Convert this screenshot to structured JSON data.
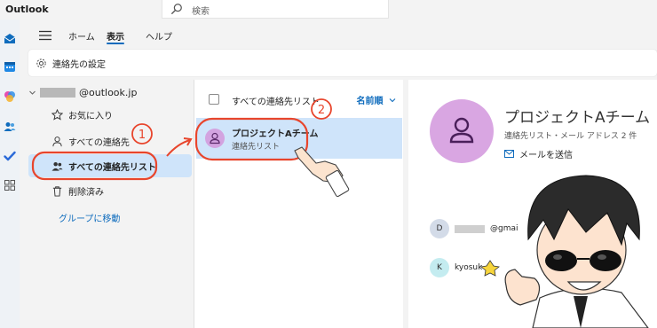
{
  "app": {
    "title": "Outlook"
  },
  "search": {
    "placeholder": "検索"
  },
  "ribbon": {
    "tabs": [
      {
        "label": "ホーム"
      },
      {
        "label": "表示"
      },
      {
        "label": "ヘルプ"
      }
    ],
    "command": "連絡先の設定"
  },
  "folders": {
    "account_suffix": "@outlook.jp",
    "items": [
      {
        "label": "お気に入り",
        "icon": "star-icon"
      },
      {
        "label": "すべての連絡先",
        "icon": "person-icon"
      },
      {
        "label": "すべての連絡先リスト",
        "icon": "people-icon",
        "selected": true
      },
      {
        "label": "削除済み",
        "icon": "trash-icon"
      }
    ],
    "group_link": "グループに移動"
  },
  "list": {
    "header_title": "すべての連絡先リスト",
    "sort_label": "名前順",
    "items": [
      {
        "name": "プロジェクトAチーム",
        "subtitle": "連絡先リスト"
      }
    ]
  },
  "detail": {
    "name": "プロジェクトAチーム",
    "subtitle": "連絡先リスト・メール アドレス 2 件",
    "send_label": "メールを送信",
    "members": [
      {
        "initial": "D",
        "email_suffix": "@gmai"
      },
      {
        "initial": "K",
        "email_prefix": "kyosuk"
      }
    ]
  },
  "annotations": {
    "step1": "1",
    "step2": "2"
  },
  "colors": {
    "accent": "#0f6cbd",
    "selected_bg": "#cfe4fa",
    "avatar_purple": "#d9a6e2",
    "annotation_red": "#e8452c"
  }
}
